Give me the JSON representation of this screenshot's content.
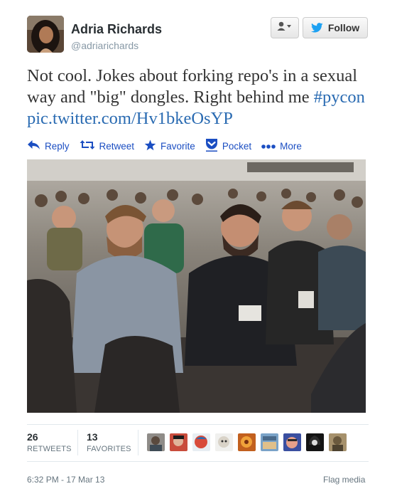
{
  "author": {
    "name": "Adria Richards",
    "handle": "@adriarichards"
  },
  "header": {
    "user_menu_icon": "user-dropdown-icon",
    "follow_label": "Follow"
  },
  "tweet": {
    "text_part1": "Not cool.  Jokes about forking repo's in a sexual way and \"big\" dongles.  Right behind me ",
    "hashtag": "#pycon",
    "media_link": "pic.twitter.com/Hv1bkeOsYP"
  },
  "actions": [
    {
      "label": "Reply",
      "icon": "reply-icon"
    },
    {
      "label": "Retweet",
      "icon": "retweet-icon"
    },
    {
      "label": "Favorite",
      "icon": "star-icon"
    },
    {
      "label": "Pocket",
      "icon": "pocket-icon"
    },
    {
      "label": "More",
      "icon": "more-dots-icon"
    }
  ],
  "stats": {
    "retweets_count": "26",
    "retweets_label": "RETWEETS",
    "favorites_count": "13",
    "favorites_label": "FAVORITES"
  },
  "footer": {
    "timestamp": "6:32 PM - 17 Mar 13",
    "flag_label": "Flag media"
  },
  "colors": {
    "link": "#2a6bb2",
    "action": "#1b4ec2",
    "follow_bird": "#1da1f2"
  }
}
